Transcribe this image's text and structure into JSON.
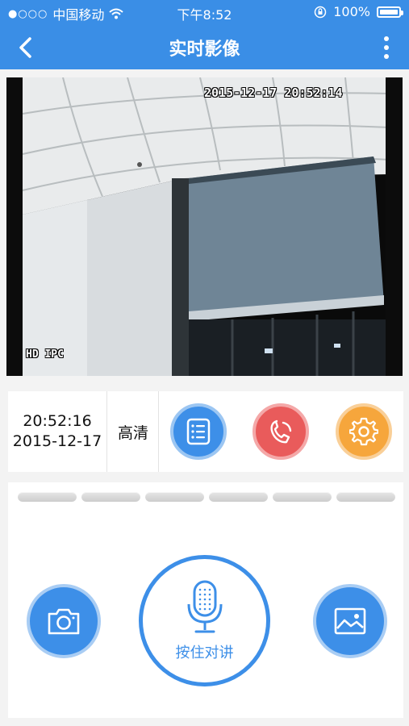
{
  "status_bar": {
    "signal_dots": "●○○○",
    "carrier": "中国移动",
    "time": "下午8:52",
    "battery": "100%",
    "wifi_icon": "wifi-icon",
    "lock_icon": "rotation-lock-icon"
  },
  "nav": {
    "title": "实时影像",
    "back_icon": "chevron-left-icon",
    "more_icon": "more-vertical-icon"
  },
  "video": {
    "osd_timestamp": "2015-12-17 20:52:14",
    "osd_camera": "HD IPC"
  },
  "controls": {
    "time": "20:52:16",
    "date": "2015-12-17",
    "quality": "高清",
    "list_icon": "list-icon",
    "call_icon": "phone-icon",
    "settings_icon": "gear-icon"
  },
  "talk_panel": {
    "talk_label": "按住对讲",
    "photo_icon": "camera-icon",
    "mic_icon": "microphone-icon",
    "gallery_icon": "image-icon"
  },
  "colors": {
    "primary": "#3a8ee6",
    "call": "#e95b5b",
    "settings": "#f6a63c"
  }
}
